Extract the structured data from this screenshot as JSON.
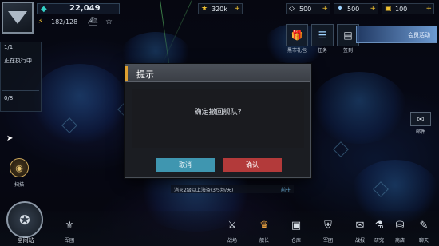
{
  "top_bar": {
    "power_value": "22,049",
    "fleet_count": "182/128",
    "resources": [
      {
        "icon": "star-icon",
        "value": "320k",
        "color": "#f1c232"
      },
      {
        "icon": "crystal-icon",
        "value": "500",
        "color": "#e0e6ee"
      },
      {
        "icon": "gem-icon",
        "value": "500",
        "color": "#9fd3ff"
      },
      {
        "icon": "chest-icon",
        "value": "100",
        "color": "#f1c232"
      }
    ]
  },
  "quick_menu": {
    "items": [
      "黑市礼包",
      "任务",
      "签到"
    ],
    "event_label": "会员活动"
  },
  "left_panel": {
    "row1": "1/1",
    "row2": "正在执行中",
    "row3": "0/8"
  },
  "dialog": {
    "title": "提示",
    "message": "确定撤回舰队?",
    "cancel_label": "取消",
    "confirm_label": "确认"
  },
  "map": {
    "info_text": "消灭2级以上海盗(3/5场/天)",
    "info_go": "前往"
  },
  "side_buttons": {
    "mail_label": "邮件",
    "scan_label": "扫描"
  },
  "bottom_nav": {
    "station_label": "空间站",
    "items": [
      "军团",
      "战场",
      "舰长",
      "仓库",
      "军团",
      "战报",
      "研究",
      "商店",
      "聊天"
    ]
  },
  "colors": {
    "accent": "#e0a030",
    "cancel": "#3f96b0",
    "confirm": "#b33a3a"
  }
}
